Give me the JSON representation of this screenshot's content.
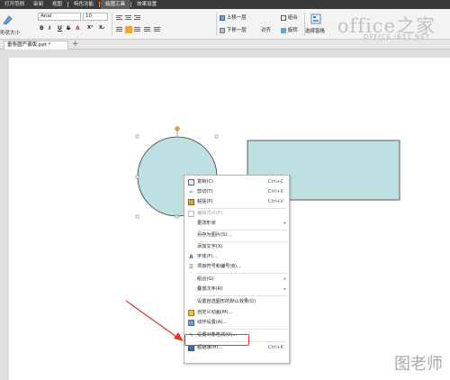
{
  "menubar": {
    "items": [
      {
        "label": "打开范例",
        "active": false
      },
      {
        "label": "审阅",
        "active": false
      },
      {
        "label": "视图",
        "active": false
      },
      {
        "label": "特色功能",
        "active": false
      },
      {
        "label": "绘图工具",
        "active": true
      },
      {
        "label": "效果设置",
        "active": false
      }
    ]
  },
  "ribbon": {
    "shape_label": "形状大小",
    "font_name": "Arial",
    "font_size": "10",
    "format_buttons": [
      "B",
      "I",
      "U",
      "S",
      "A",
      "X²",
      "X₂"
    ],
    "bring_forward": "上移一层",
    "send_backward": "下移一层",
    "align": "对齐",
    "group": "组合",
    "rotate": "旋转",
    "selection_pane": "选择窗格"
  },
  "watermark": {
    "brand": "office之家",
    "url": "OFFICE.JB51.NET"
  },
  "document_tab": {
    "title": "垂条圆严谱版.ppt *",
    "new_tab": "+"
  },
  "context_menu": {
    "items": [
      {
        "label": "复制(C)",
        "shortcut": "Ctrl+C",
        "icon": "copy-icon",
        "disabled": false,
        "submenu": false
      },
      {
        "label": "剪切(T)",
        "shortcut": "Ctrl+X",
        "icon": "cut-icon",
        "disabled": false,
        "submenu": false
      },
      {
        "label": "粘贴(P)",
        "shortcut": "Ctrl+V",
        "icon": "paste-icon",
        "disabled": false,
        "submenu": false
      },
      {
        "label": "编辑顶点(E)",
        "shortcut": "",
        "icon": "edit-points-icon",
        "disabled": true,
        "submenu": false
      },
      {
        "label": "更改形状",
        "shortcut": "",
        "icon": "",
        "disabled": false,
        "submenu": true
      },
      {
        "label": "另存为图片(S)...",
        "shortcut": "",
        "icon": "",
        "disabled": false,
        "submenu": false
      },
      {
        "label": "添加文字(X)",
        "shortcut": "",
        "icon": "",
        "disabled": false,
        "submenu": false
      },
      {
        "label": "字体(F)...",
        "shortcut": "",
        "icon": "font-icon",
        "disabled": false,
        "submenu": false
      },
      {
        "label": "项目符号和编号(B)...",
        "shortcut": "",
        "icon": "bullets-icon",
        "disabled": false,
        "submenu": false
      },
      {
        "label": "组合(G)",
        "shortcut": "",
        "icon": "",
        "disabled": false,
        "submenu": true
      },
      {
        "label": "叠放次序(R)",
        "shortcut": "",
        "icon": "",
        "disabled": false,
        "submenu": true
      },
      {
        "label": "设置自选图形的默认效果(D)",
        "shortcut": "",
        "icon": "",
        "disabled": false,
        "submenu": false
      },
      {
        "label": "自定义动画(M)...",
        "shortcut": "",
        "icon": "animation-icon",
        "disabled": false,
        "submenu": false
      },
      {
        "label": "动作设置(A)...",
        "shortcut": "",
        "icon": "action-icon",
        "disabled": false,
        "submenu": false
      },
      {
        "label": "设置对象格式(O)...",
        "shortcut": "",
        "icon": "format-object-icon",
        "disabled": false,
        "submenu": false
      },
      {
        "label": "超链接(H)...",
        "shortcut": "Ctrl+K",
        "icon": "hyperlink-icon",
        "disabled": false,
        "submenu": false
      }
    ]
  },
  "colors": {
    "shape_fill": "#bfe0e2",
    "shape_stroke": "#3b3b3b",
    "highlight": "#e03a2a",
    "arrow": "#e03a2a",
    "rotate_handle": "#f0a030"
  },
  "bottom_logo": "图老师"
}
